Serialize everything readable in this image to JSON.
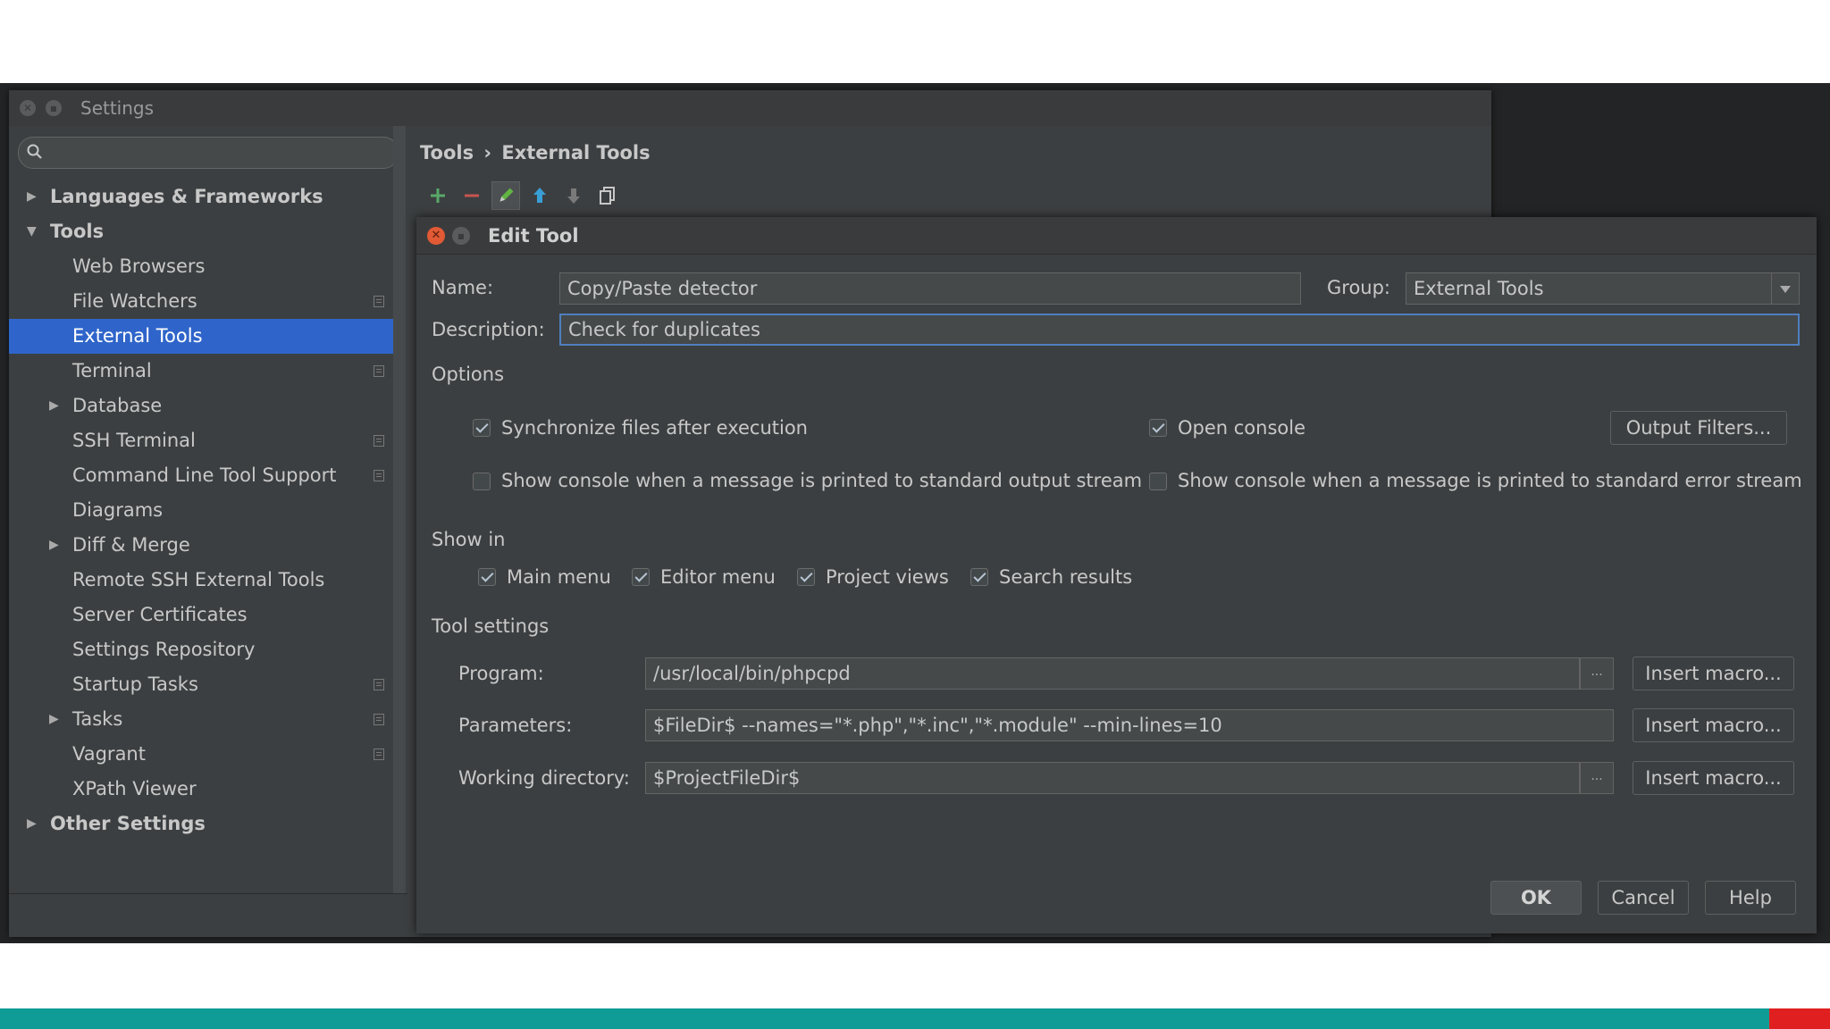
{
  "settings": {
    "title": "Settings",
    "search_placeholder": "",
    "tree": [
      {
        "label": "Languages & Frameworks",
        "level": 0,
        "expanded": false,
        "bold": true
      },
      {
        "label": "Tools",
        "level": 0,
        "expanded": true,
        "bold": true
      },
      {
        "label": "Web Browsers",
        "level": 1
      },
      {
        "label": "File Watchers",
        "level": 1,
        "project": true
      },
      {
        "label": "External Tools",
        "level": 1,
        "selected": true
      },
      {
        "label": "Terminal",
        "level": 1,
        "project": true
      },
      {
        "label": "Database",
        "level": 1,
        "expandable": true
      },
      {
        "label": "SSH Terminal",
        "level": 1,
        "project": true
      },
      {
        "label": "Command Line Tool Support",
        "level": 1,
        "project": true
      },
      {
        "label": "Diagrams",
        "level": 1
      },
      {
        "label": "Diff & Merge",
        "level": 1,
        "expandable": true
      },
      {
        "label": "Remote SSH External Tools",
        "level": 1
      },
      {
        "label": "Server Certificates",
        "level": 1
      },
      {
        "label": "Settings Repository",
        "level": 1
      },
      {
        "label": "Startup Tasks",
        "level": 1,
        "project": true
      },
      {
        "label": "Tasks",
        "level": 1,
        "expandable": true,
        "project": true
      },
      {
        "label": "Vagrant",
        "level": 1,
        "project": true
      },
      {
        "label": "XPath Viewer",
        "level": 1
      },
      {
        "label": "Other Settings",
        "level": 0,
        "expanded": false,
        "bold": true
      }
    ],
    "breadcrumb": {
      "parent": "Tools",
      "separator": "›",
      "current": "External Tools"
    },
    "toolbar": [
      "add-icon",
      "remove-icon",
      "edit-icon",
      "move-up-icon",
      "move-down-icon",
      "copy-icon"
    ]
  },
  "dialog": {
    "title": "Edit Tool",
    "name_label": "Name:",
    "name_value": "Copy/Paste detector",
    "group_label": "Group:",
    "group_value": "External Tools",
    "description_label": "Description:",
    "description_value": "Check for duplicates",
    "options_heading": "Options",
    "sync_files_label": "Synchronize files after execution",
    "sync_files_checked": true,
    "open_console_label": "Open console",
    "open_console_checked": true,
    "output_filters_label": "Output Filters...",
    "show_console_stdout_label": "Show console when a message is printed to standard output stream",
    "show_console_stdout_checked": false,
    "show_console_stderr_label": "Show console when a message is printed to standard error stream",
    "show_console_stderr_checked": false,
    "show_in_heading": "Show in",
    "main_menu_label": "Main menu",
    "editor_menu_label": "Editor menu",
    "project_views_label": "Project views",
    "search_results_label": "Search results",
    "tool_settings_heading": "Tool settings",
    "program_label": "Program:",
    "program_value": "/usr/local/bin/phpcpd",
    "parameters_label": "Parameters:",
    "parameters_value": "$FileDir$ --names=\"*.php\",\"*.inc\",\"*.module\" --min-lines=10",
    "working_dir_label": "Working directory:",
    "working_dir_value": "$ProjectFileDir$",
    "insert_macro_label": "Insert macro...",
    "ellipsis": "...",
    "ok_label": "OK",
    "cancel_label": "Cancel",
    "help_label": "Help"
  },
  "colors": {
    "selection": "#2f65ca",
    "background": "#3c3f41",
    "add_icon": "#59a869",
    "remove_icon": "#c75450",
    "edit_icon": "#62b543",
    "arrow_icon": "#389fd6",
    "close_button": "#e15a35",
    "accent_teal": "#0f9c96",
    "accent_red": "#e02020"
  }
}
